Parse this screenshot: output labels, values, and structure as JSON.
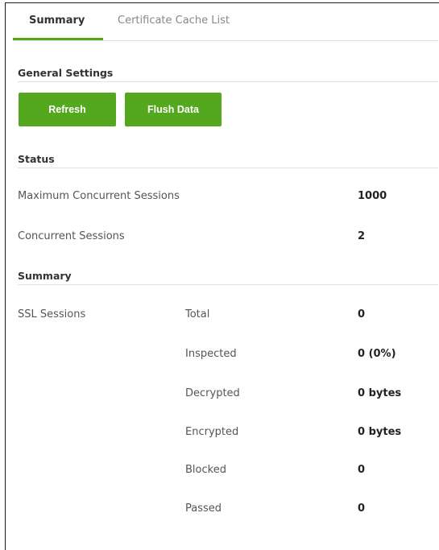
{
  "tabs": [
    {
      "label": "Summary",
      "active": true
    },
    {
      "label": "Certificate Cache List",
      "active": false
    }
  ],
  "general_settings": {
    "title": "General Settings",
    "refresh_label": "Refresh",
    "flush_label": "Flush Data"
  },
  "status": {
    "title": "Status",
    "max_sessions_label": "Maximum Concurrent Sessions",
    "max_sessions_value": "1000",
    "concurrent_label": "Concurrent Sessions",
    "concurrent_value": "2"
  },
  "summary": {
    "title": "Summary",
    "group_label": "SSL Sessions",
    "rows": [
      {
        "label": "Total",
        "value": "0"
      },
      {
        "label": "Inspected",
        "value": "0 (0%)"
      },
      {
        "label": "Decrypted",
        "value": "0 bytes"
      },
      {
        "label": "Encrypted",
        "value": "0 bytes"
      },
      {
        "label": "Blocked",
        "value": "0"
      },
      {
        "label": "Passed",
        "value": "0"
      }
    ]
  },
  "colors": {
    "accent": "#54a81d",
    "tab_underline": "#52a61c"
  }
}
